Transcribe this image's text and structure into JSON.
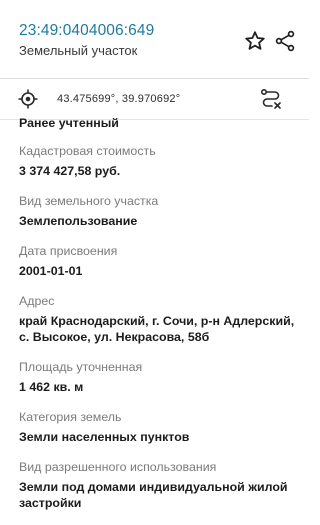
{
  "header": {
    "cadastral_number": "23:49:0404006:649",
    "subtitle": "Земельный участок"
  },
  "coords": {
    "text": "43.475699°, 39.970692°"
  },
  "details": {
    "status_value": "Ранее учтенный",
    "fields": [
      {
        "label": "Кадастровая стоимость",
        "value": "3 374 427,58 руб."
      },
      {
        "label": "Вид земельного участка",
        "value": "Землепользование"
      },
      {
        "label": "Дата присвоения",
        "value": "2001-01-01"
      },
      {
        "label": "Адрес",
        "value": "край Краснодарский, г. Сочи, р-н Адлерский, с. Высокое, ул. Некрасова, 58б"
      },
      {
        "label": "Площадь уточненная",
        "value": "1 462 кв. м"
      },
      {
        "label": "Категория земель",
        "value": "Земли населенных пунктов"
      },
      {
        "label": "Вид разрешенного использования",
        "value": "Земли под домами индивидуальной жилой застройки"
      }
    ]
  },
  "icons": {
    "favorite": "star-outline-icon",
    "share": "share-icon",
    "locate": "target-icon",
    "route": "route-icon"
  },
  "colors": {
    "cadastral_number": "#1f7aa0",
    "label": "#7b7b7b",
    "value": "#1c1c1c"
  }
}
